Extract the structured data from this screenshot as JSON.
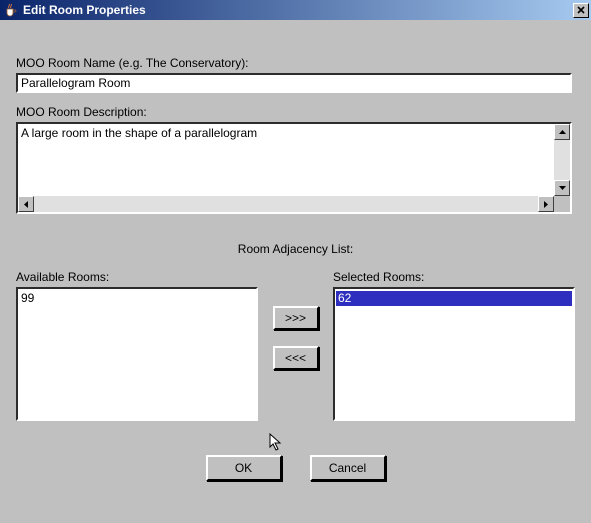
{
  "window": {
    "title": "Edit Room Properties"
  },
  "form": {
    "name_label": "MOO Room Name (e.g. The Conservatory):",
    "name_value": "Parallelogram Room",
    "desc_label": "MOO Room Description:",
    "desc_value": "A large room in the shape of a parallelogram"
  },
  "adjacency": {
    "heading": "Room Adjacency List:",
    "available_label": "Available Rooms:",
    "selected_label": "Selected Rooms:",
    "available": [
      "99"
    ],
    "selected": [
      "62"
    ],
    "add_label": ">>>",
    "remove_label": "<<<"
  },
  "buttons": {
    "ok": "OK",
    "cancel": "Cancel"
  }
}
